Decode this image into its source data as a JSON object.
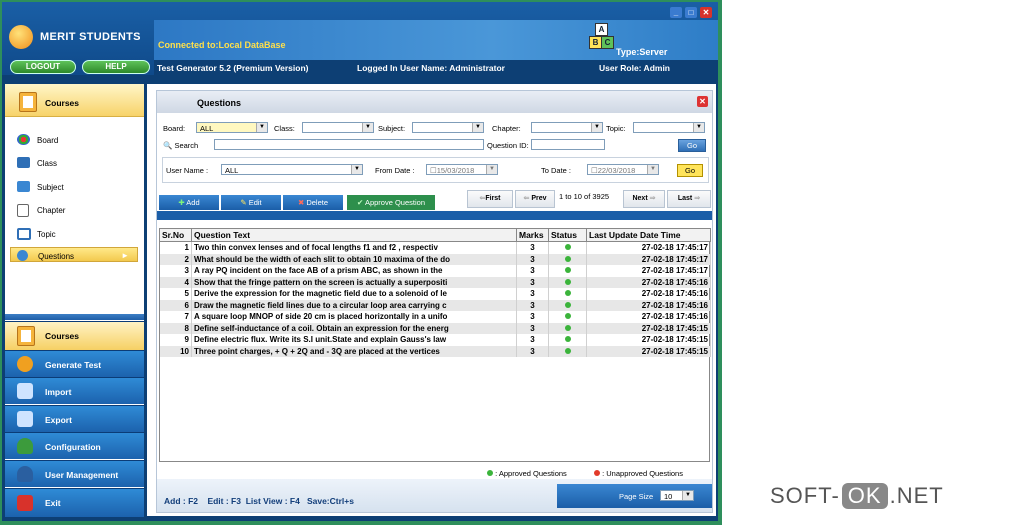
{
  "app": {
    "name": "MERIT STUDENTS",
    "logout": "LOGOUT",
    "help": "HELP",
    "connection": "Connected to:Local DataBase",
    "server_type": "Type:Server",
    "version": "Test Generator 5.2 (Premium Version)",
    "logged_in": "Logged In User Name: Administrator",
    "user_role": "User Role: Admin",
    "abc": [
      "A",
      "B",
      "C"
    ]
  },
  "sidebar": {
    "top_title": "Courses",
    "items": [
      {
        "label": "Board",
        "icon": "board-icon"
      },
      {
        "label": "Class",
        "icon": "class-icon"
      },
      {
        "label": "Subject",
        "icon": "subject-icon"
      },
      {
        "label": "Chapter",
        "icon": "chapter-icon"
      },
      {
        "label": "Topic",
        "icon": "topic-icon"
      },
      {
        "label": "Questions",
        "icon": "questions-icon"
      }
    ],
    "nav": [
      {
        "label": "Courses"
      },
      {
        "label": "Generate Test"
      },
      {
        "label": "Import"
      },
      {
        "label": "Export"
      },
      {
        "label": "Configuration"
      },
      {
        "label": "User Management"
      },
      {
        "label": "Exit"
      }
    ]
  },
  "questions": {
    "title": "Questions",
    "filters": {
      "board_label": "Board:",
      "board_value": "ALL",
      "class_label": "Class:",
      "class_value": "",
      "subject_label": "Subject:",
      "subject_value": "",
      "chapter_label": "Chapter:",
      "chapter_value": "",
      "topic_label": "Topic:",
      "topic_value": "",
      "search_label": "Search",
      "question_id_label": "Question ID:",
      "go": "Go",
      "user_name_label": "User Name :",
      "user_name_value": "ALL",
      "from_date_label": "From Date :",
      "from_date_value": "15/03/2018",
      "to_date_label": "To Date :",
      "to_date_value": "22/03/2018",
      "go2": "Go"
    },
    "toolbar": {
      "add": "Add",
      "edit": "Edit",
      "delete": "Delete",
      "approve": "Approve Question",
      "first": "First",
      "prev": "Prev",
      "range": "1 to 10 of 3925",
      "next": "Next",
      "last": "Last"
    },
    "columns": [
      "Sr.No",
      "Question Text",
      "Marks",
      "Status",
      "Last Update Date Time"
    ],
    "rows": [
      {
        "no": "1",
        "text": "Two thin convex lenses  and  of focal lengths f1 and f2  , respectiv",
        "marks": "3",
        "date": "27-02-18 17:45:17"
      },
      {
        "no": "2",
        "text": "What should be the width of each slit to obtain 10 maxima of the do",
        "marks": "3",
        "date": "27-02-18 17:45:17"
      },
      {
        "no": "3",
        "text": "A ray PQ incident on the face AB of a prism ABC, as shown in the",
        "marks": "3",
        "date": "27-02-18 17:45:17"
      },
      {
        "no": "4",
        "text": "Show that the fringe pattern on the screen is actually a superpositi",
        "marks": "3",
        "date": "27-02-18 17:45:16"
      },
      {
        "no": "5",
        "text": "Derive the expression for the magnetic field due to a solenoid of le",
        "marks": "3",
        "date": "27-02-18 17:45:16"
      },
      {
        "no": "6",
        "text": "Draw the magnetic field lines due to a circular loop area  carrying c",
        "marks": "3",
        "date": "27-02-18 17:45:16"
      },
      {
        "no": "7",
        "text": "A square loop MNOP of side 20 cm is placed horizontally in a unifo",
        "marks": "3",
        "date": "27-02-18 17:45:16"
      },
      {
        "no": "8",
        "text": "Define self-inductance of a coil. Obtain an expression for the energ",
        "marks": "3",
        "date": "27-02-18 17:45:15"
      },
      {
        "no": "9",
        "text": "Define electric flux. Write its S.I unit.State and explain Gauss's law",
        "marks": "3",
        "date": "27-02-18 17:45:15"
      },
      {
        "no": "10",
        "text": "Three point charges, + Q + 2Q and - 3Q are placed at the vertices",
        "marks": "3",
        "date": "27-02-18 17:45:15"
      }
    ],
    "legend_approved": ": Approved Questions",
    "legend_unapproved": ": Unapproved Questions",
    "shortcuts": "Add : F2    Edit : F3  List View : F4   Save:Ctrl+s",
    "page_size_label": "Page Size",
    "page_size_value": "10"
  },
  "colors": {
    "approved": "#3bb43b",
    "unapproved": "#e23b2b",
    "accent": "#1b5ea8"
  },
  "watermark": {
    "a": "SOFT-",
    "b": "OK",
    "c": ".NET"
  }
}
